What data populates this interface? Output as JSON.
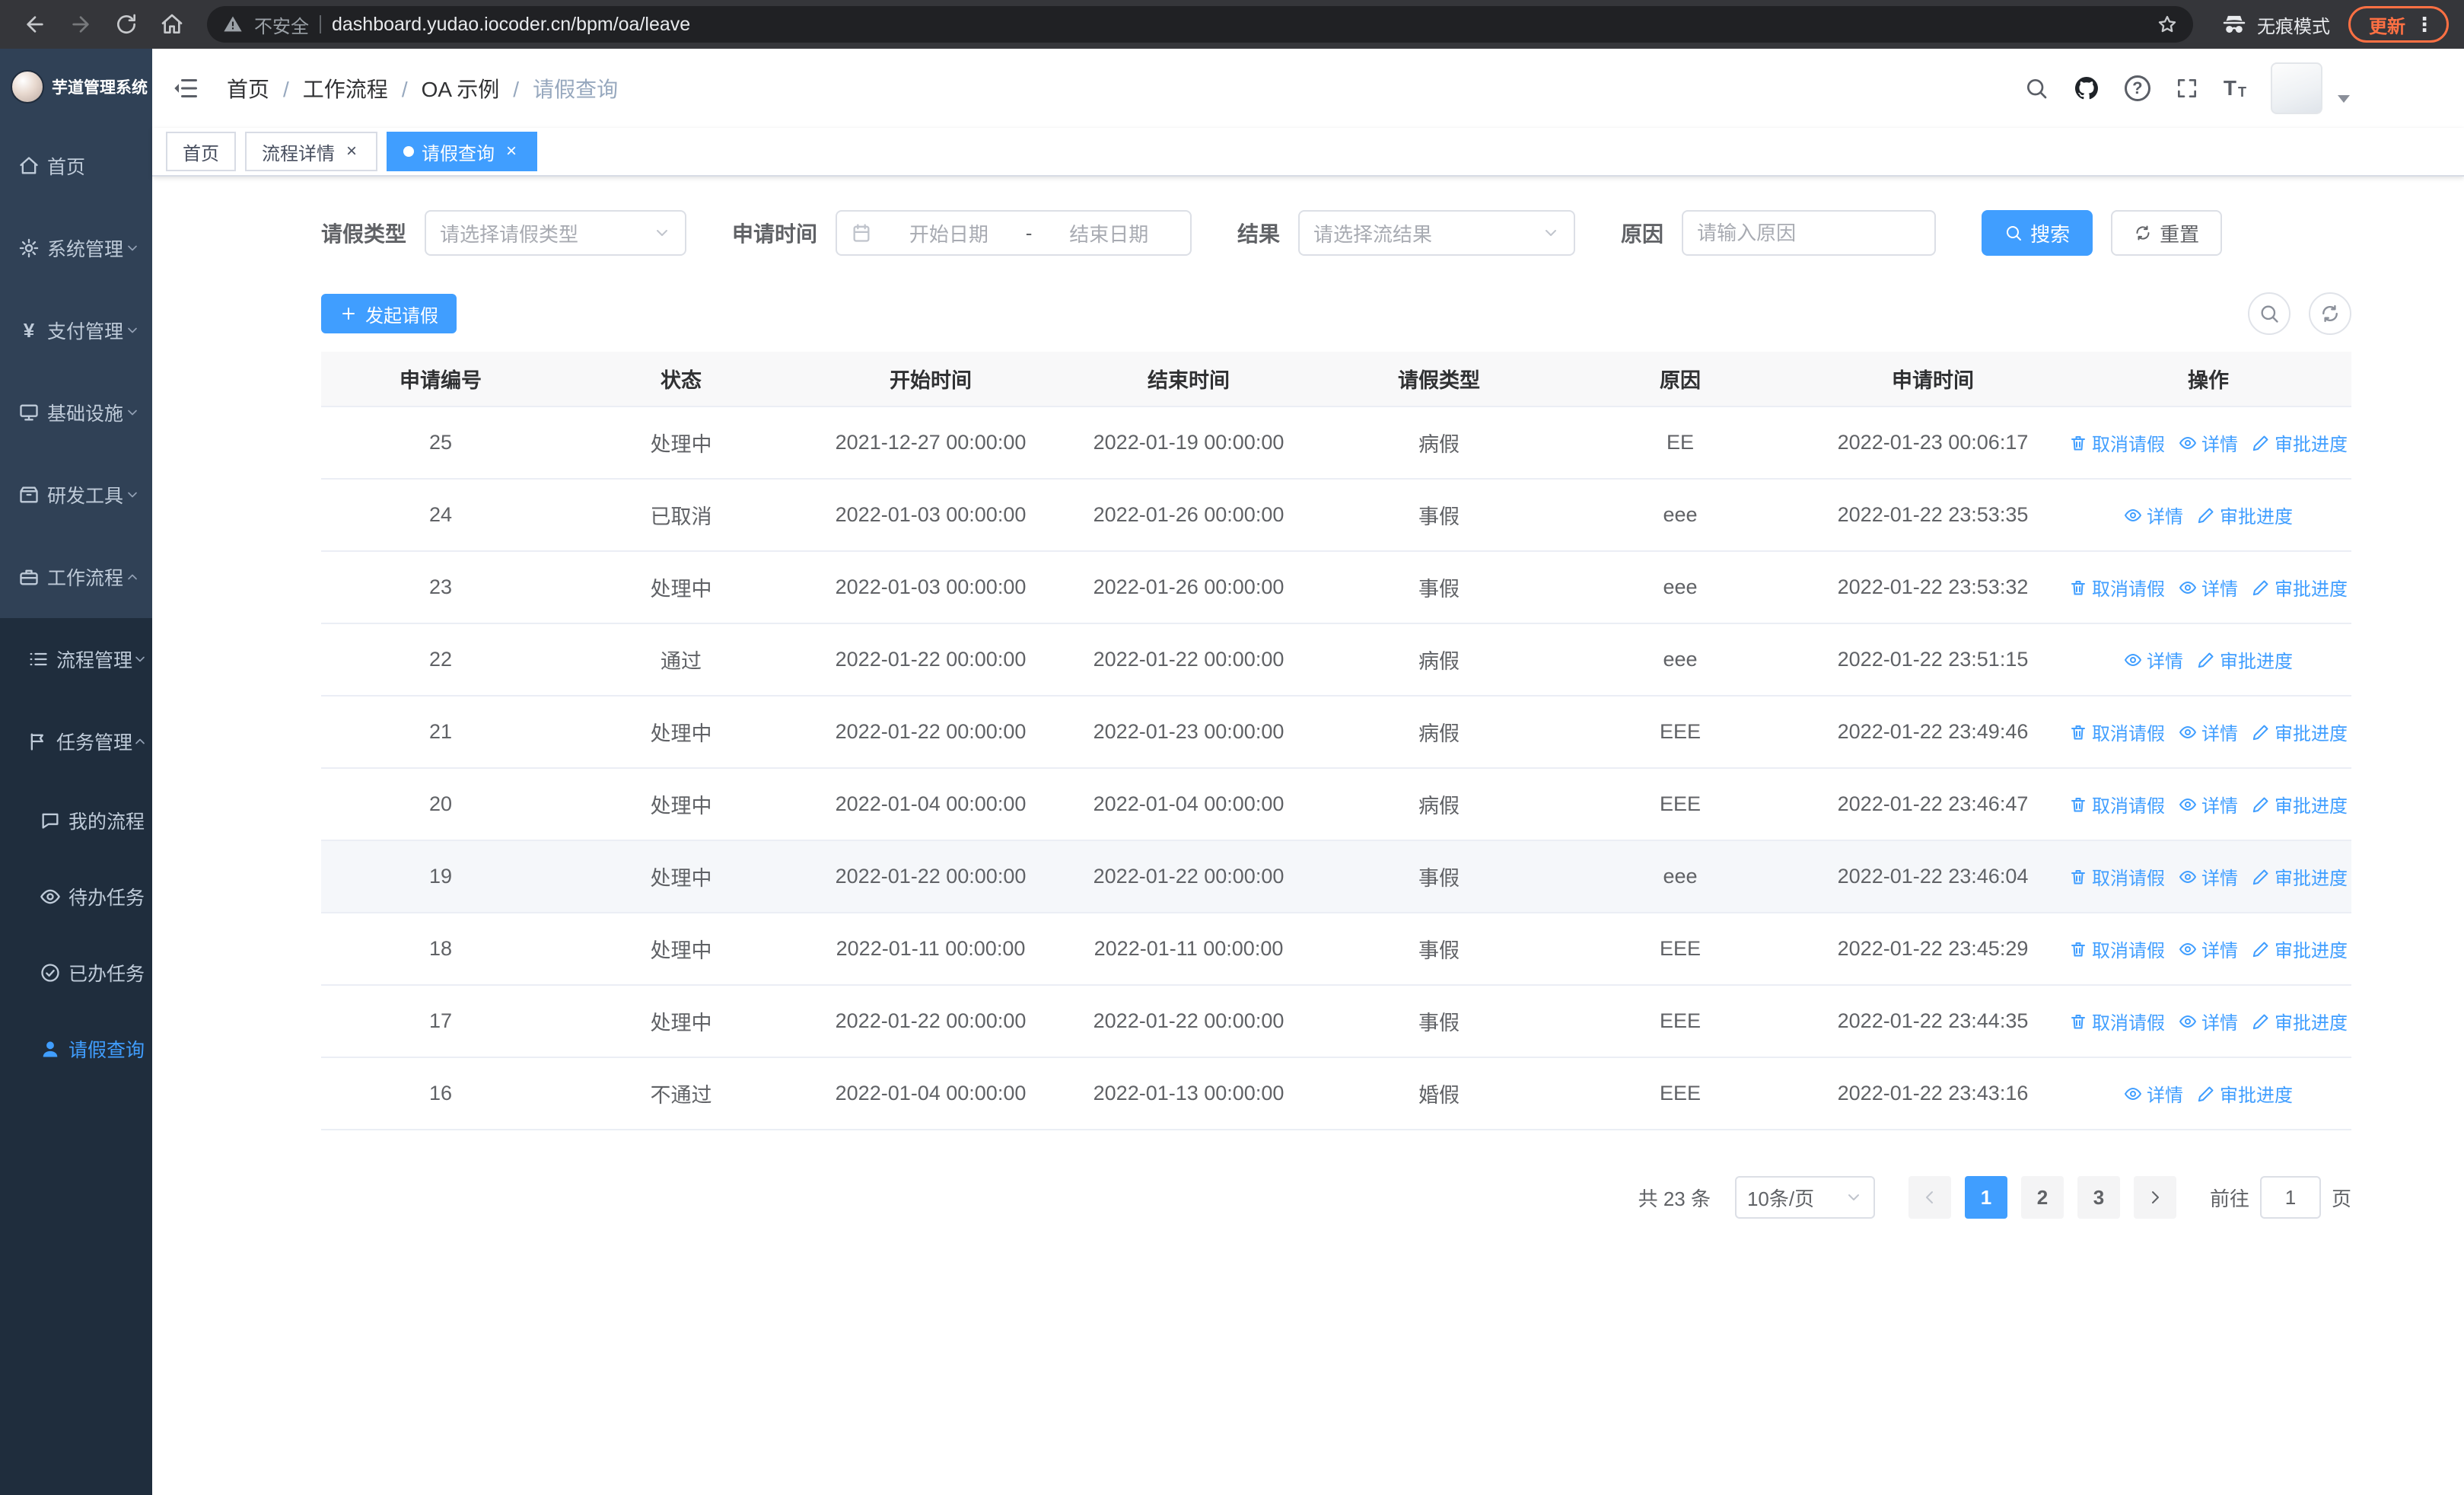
{
  "browser": {
    "security_label": "不安全",
    "url": "dashboard.yudao.iocoder.cn/bpm/oa/leave",
    "incognito_label": "无痕模式",
    "update_label": "更新"
  },
  "sidebar": {
    "title": "芋道管理系统",
    "menu": [
      "首页",
      "系统管理",
      "支付管理",
      "基础设施",
      "研发工具",
      "工作流程",
      "流程管理",
      "任务管理",
      "我的流程",
      "待办任务",
      "已办任务",
      "请假查询"
    ]
  },
  "breadcrumb": {
    "items": [
      "首页",
      "工作流程",
      "OA 示例",
      "请假查询"
    ]
  },
  "tabs": {
    "items": [
      {
        "label": "首页"
      },
      {
        "label": "流程详情"
      },
      {
        "label": "请假查询"
      }
    ]
  },
  "filters": {
    "leave_type_label": "请假类型",
    "leave_type_placeholder": "请选择请假类型",
    "apply_time_label": "申请时间",
    "start_date_placeholder": "开始日期",
    "range_separator": "-",
    "end_date_placeholder": "结束日期",
    "result_label": "结果",
    "result_placeholder": "请选择流结果",
    "reason_label": "原因",
    "reason_placeholder": "请输入原因",
    "search_button": "搜索",
    "reset_button": "重置"
  },
  "toolbar": {
    "create_button": "发起请假"
  },
  "table": {
    "columns": [
      "申请编号",
      "状态",
      "开始时间",
      "结束时间",
      "请假类型",
      "原因",
      "申请时间",
      "操作"
    ],
    "ops_labels": {
      "cancel": "取消请假",
      "detail": "详情",
      "progress": "审批进度"
    },
    "rows": [
      {
        "id": "25",
        "status": "处理中",
        "start": "2021-12-27 00:00:00",
        "end": "2022-01-19 00:00:00",
        "type": "病假",
        "reason": "EE",
        "applied": "2022-01-23 00:06:17"
      },
      {
        "id": "24",
        "status": "已取消",
        "start": "2022-01-03 00:00:00",
        "end": "2022-01-26 00:00:00",
        "type": "事假",
        "reason": "eee",
        "applied": "2022-01-22 23:53:35"
      },
      {
        "id": "23",
        "status": "处理中",
        "start": "2022-01-03 00:00:00",
        "end": "2022-01-26 00:00:00",
        "type": "事假",
        "reason": "eee",
        "applied": "2022-01-22 23:53:32"
      },
      {
        "id": "22",
        "status": "通过",
        "start": "2022-01-22 00:00:00",
        "end": "2022-01-22 00:00:00",
        "type": "病假",
        "reason": "eee",
        "applied": "2022-01-22 23:51:15"
      },
      {
        "id": "21",
        "status": "处理中",
        "start": "2022-01-22 00:00:00",
        "end": "2022-01-23 00:00:00",
        "type": "病假",
        "reason": "EEE",
        "applied": "2022-01-22 23:49:46"
      },
      {
        "id": "20",
        "status": "处理中",
        "start": "2022-01-04 00:00:00",
        "end": "2022-01-04 00:00:00",
        "type": "病假",
        "reason": "EEE",
        "applied": "2022-01-22 23:46:47"
      },
      {
        "id": "19",
        "status": "处理中",
        "start": "2022-01-22 00:00:00",
        "end": "2022-01-22 00:00:00",
        "type": "事假",
        "reason": "eee",
        "applied": "2022-01-22 23:46:04"
      },
      {
        "id": "18",
        "status": "处理中",
        "start": "2022-01-11 00:00:00",
        "end": "2022-01-11 00:00:00",
        "type": "事假",
        "reason": "EEE",
        "applied": "2022-01-22 23:45:29"
      },
      {
        "id": "17",
        "status": "处理中",
        "start": "2022-01-22 00:00:00",
        "end": "2022-01-22 00:00:00",
        "type": "事假",
        "reason": "EEE",
        "applied": "2022-01-22 23:44:35"
      },
      {
        "id": "16",
        "status": "不通过",
        "start": "2022-01-04 00:00:00",
        "end": "2022-01-13 00:00:00",
        "type": "婚假",
        "reason": "EEE",
        "applied": "2022-01-22 23:43:16"
      }
    ]
  },
  "pagination": {
    "total": "共 23 条",
    "page_size": "10条/页",
    "pages": [
      "1",
      "2",
      "3"
    ],
    "goto_label": "前往",
    "goto_value": "1",
    "page_unit": "页"
  },
  "colors": {
    "accent": "#409eff",
    "sidebar_bg": "#304156",
    "submenu_bg": "#1f2d3d",
    "update_badge": "#ff7043"
  },
  "icons": {
    "not_secure": "warning-triangle",
    "ops_cancel": "trash",
    "ops_detail": "eye",
    "ops_progress": "pen"
  }
}
